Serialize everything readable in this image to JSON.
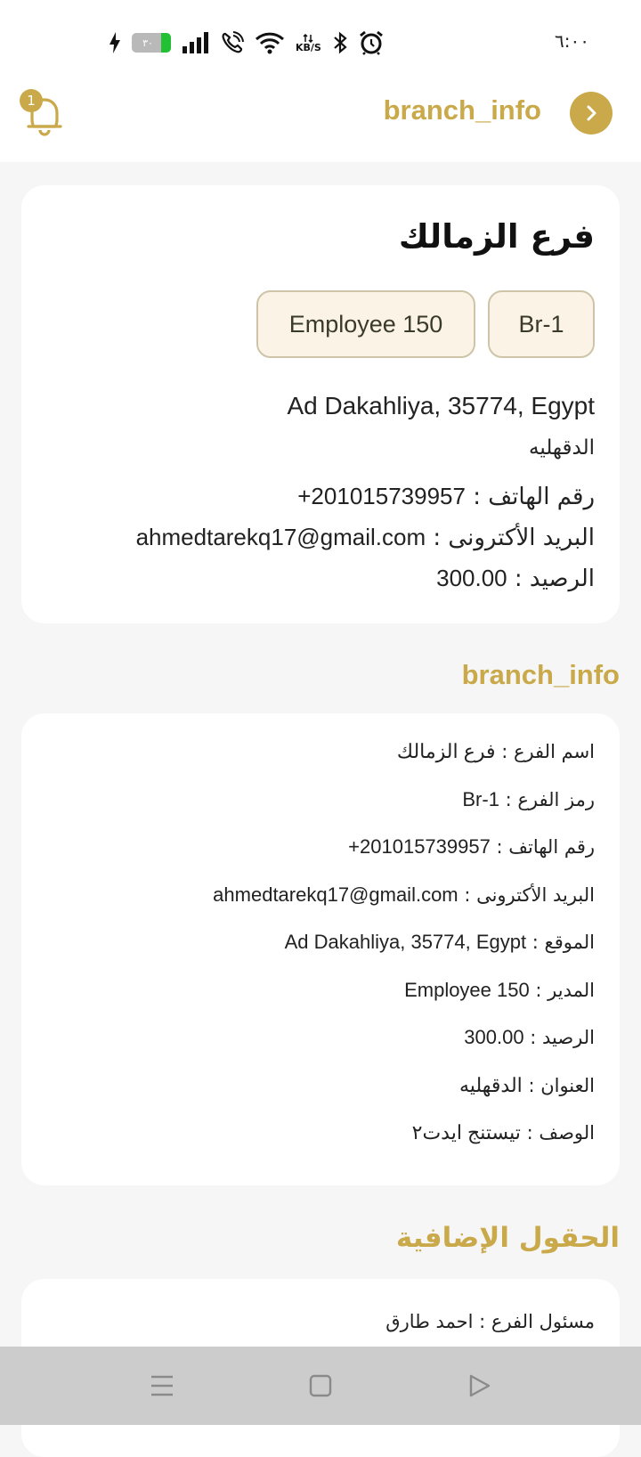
{
  "status_bar": {
    "time": "٦:٠٠",
    "battery_level": "٣٠",
    "speed_unit": "KB/S",
    "icons": [
      "charging-icon",
      "battery-icon",
      "signal-icon",
      "wifi-call-icon",
      "wifi-icon",
      "network-speed-icon",
      "bluetooth-icon",
      "alarm-icon"
    ]
  },
  "app_bar": {
    "title": "branch_info",
    "notification_count": "1",
    "icons": [
      "bell-icon",
      "chevron-right-icon"
    ]
  },
  "summary_card": {
    "branch_name": "فرع الزمالك",
    "chips": {
      "code": "Br-1",
      "manager": "Employee 150"
    },
    "address": "Ad Dakahliya, 35774, Egypt",
    "governorate": "الدقهليه",
    "phone_label": "رقم الهاتف : ",
    "phone_value": "+201015739957",
    "email_label": "البريد الأكترونى : ",
    "email_value": "ahmedtarekq17@gmail.com",
    "balance_label": "الرصيد : ",
    "balance_value": "300.00"
  },
  "branch_info_section": {
    "title": "branch_info",
    "rows": [
      {
        "label": "اسم الفرع : ",
        "value": "فرع الزمالك"
      },
      {
        "label": "رمز الفرع : ",
        "value": "Br-1"
      },
      {
        "label": "رقم الهاتف : ",
        "value": "+201015739957"
      },
      {
        "label": "البريد الأكترونى : ",
        "value": "ahmedtarekq17@gmail.com"
      },
      {
        "label": "الموقع : ",
        "value": "Ad Dakahliya, 35774, Egypt"
      },
      {
        "label": "المدير : ",
        "value": "Employee 150"
      },
      {
        "label": "الرصيد : ",
        "value": "300.00"
      },
      {
        "label": "العنوان : ",
        "value": "الدقهليه"
      },
      {
        "label": "الوصف : ",
        "value": "تيستنج ايدت٢"
      }
    ]
  },
  "extra_fields_section": {
    "title": "الحقول الإضافية",
    "rows": [
      {
        "label": "مسئول الفرع  : ",
        "value": "احمد طارق"
      }
    ]
  },
  "colors": {
    "accent": "#c9a94a",
    "chip_background": "#fbf4e6",
    "chip_border": "#cfc3a8",
    "page_background": "#f6f6f6",
    "nav_bar": "#cccccc"
  },
  "nav_bar": {
    "icons": [
      "menu-icon",
      "home-square-icon",
      "back-triangle-icon"
    ]
  }
}
